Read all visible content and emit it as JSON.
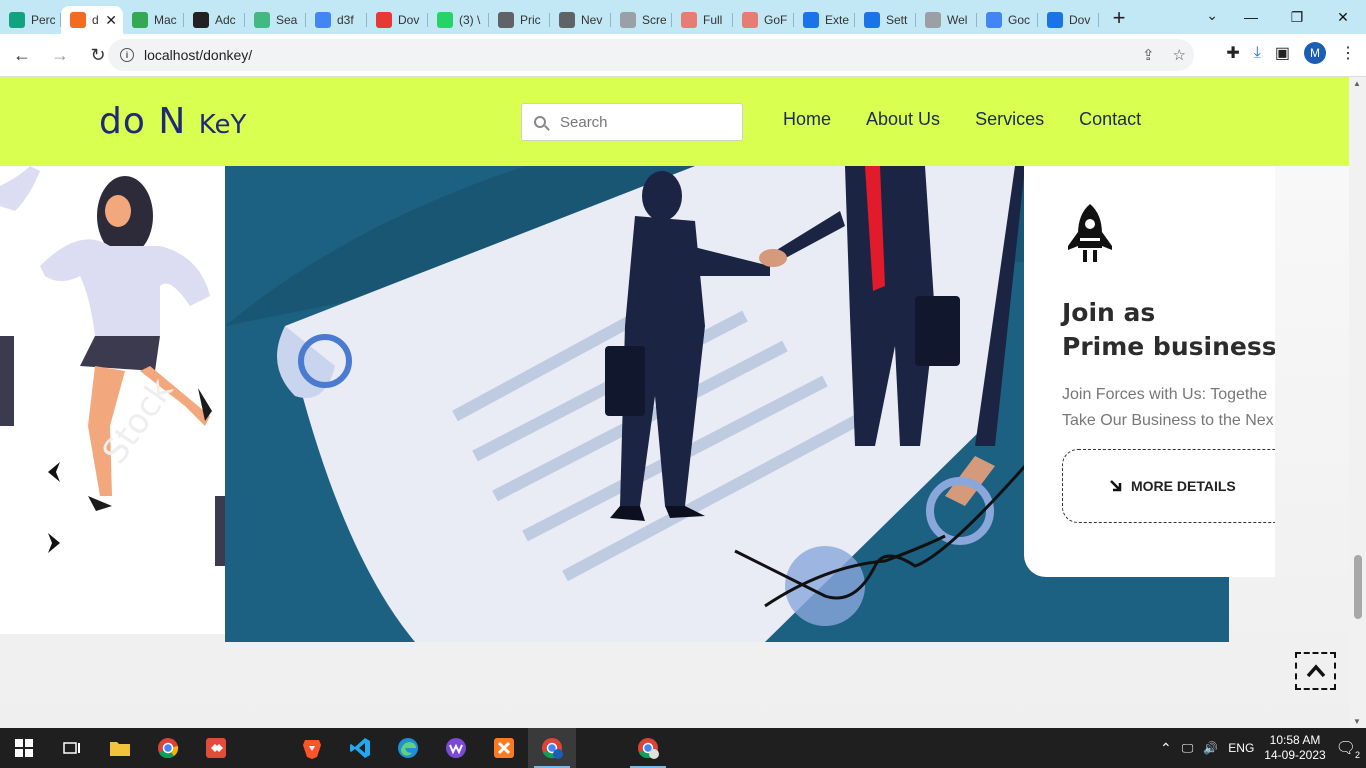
{
  "browser": {
    "tabs": [
      {
        "title": "Perc",
        "icon": "openai-icon",
        "color": "#10a37f"
      },
      {
        "title": "d",
        "icon": "donkey-favicon-icon",
        "color": "#f26b21",
        "active": true
      },
      {
        "title": "Mac",
        "icon": "maps-icon",
        "color": "#34a853"
      },
      {
        "title": "Adc",
        "icon": "hex-icon",
        "color": "#222222"
      },
      {
        "title": "Sea",
        "icon": "vue-icon",
        "color": "#42b883"
      },
      {
        "title": "d3f",
        "icon": "google-icon",
        "color": "#4285f4"
      },
      {
        "title": "Dov",
        "icon": "donkey-red-icon",
        "color": "#e53935"
      },
      {
        "title": "(3) \\",
        "icon": "whatsapp-icon",
        "color": "#25d366"
      },
      {
        "title": "Pric",
        "icon": "globe-icon",
        "color": "#5f6368"
      },
      {
        "title": "Nev",
        "icon": "chrome-icon",
        "color": "#5f6368"
      },
      {
        "title": "Scre",
        "icon": "doc-icon",
        "color": "#9aa0a6"
      },
      {
        "title": "Full",
        "icon": "rainbow-icon",
        "color": "#e67c73"
      },
      {
        "title": "GoF",
        "icon": "rainbow-icon",
        "color": "#e67c73"
      },
      {
        "title": "Exte",
        "icon": "puzzle-icon",
        "color": "#1a73e8"
      },
      {
        "title": "Sett",
        "icon": "gear-icon",
        "color": "#1a73e8"
      },
      {
        "title": "Wel",
        "icon": "camera-icon",
        "color": "#9aa0a6"
      },
      {
        "title": "Goc",
        "icon": "google-icon",
        "color": "#4285f4"
      },
      {
        "title": "Dov",
        "icon": "download-icon",
        "color": "#1a73e8"
      }
    ],
    "url": "localhost/donkey/",
    "profile_initial": "M"
  },
  "site": {
    "logo_main": "do N ",
    "logo_tail": "KeY",
    "search_placeholder": "Search",
    "nav": [
      "Home",
      "About Us",
      "Services",
      "Contact"
    ],
    "card": {
      "title_line1": "Join as",
      "title_line2": "Prime business pa",
      "text_line1": "Join Forces with Us: Togethe",
      "text_line2": "Take Our Business to the Nex",
      "button_label": "MORE DETAILS"
    },
    "prev_arrow": "‹",
    "next_arrow": "›"
  },
  "taskbar": {
    "lang": "ENG",
    "time": "10:58 AM",
    "date": "14-09-2023",
    "notifications": "2"
  }
}
